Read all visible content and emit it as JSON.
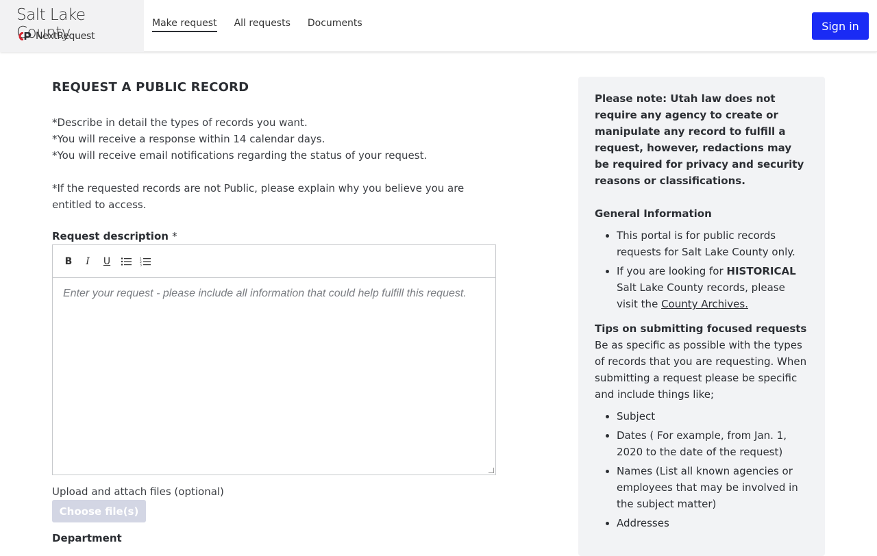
{
  "header": {
    "brand_title": "Salt Lake County",
    "brand_sub": "NextRequest",
    "nav": [
      "Make request",
      "All requests",
      "Documents"
    ],
    "sign_in": "Sign in"
  },
  "main": {
    "title": "REQUEST A PUBLIC RECORD",
    "intro_lines": [
      "*Describe in detail the types of records you want.",
      "*You will receive a response within 14 calendar days.",
      "*You will receive email notifications regarding the status of your request.",
      "*If the requested records are not Public, please explain why you believe you are entitled to access."
    ],
    "desc_label": "Request description",
    "required_mark": "*",
    "toolbar": {
      "bold": "B",
      "italic": "I",
      "underline": "U"
    },
    "placeholder": "Enter your request - please include all information that could help fulfill this request.",
    "upload_label": "Upload and attach files (optional)",
    "choose_files": "Choose file(s)",
    "department_label": "Department"
  },
  "sidebar": {
    "note": "Please note: Utah law does not require any agency to create or manipulate any record to fulfill a request, however, redactions may be required for privacy and security reasons or classifications.",
    "general_heading": "General Information",
    "general_item1": "This portal is for public records requests for Salt Lake County only.",
    "general_item2_pre": "If you are looking for ",
    "general_item2_bold": "HISTORICAL",
    "general_item2_mid": " Salt Lake County records, please visit the ",
    "general_item2_link": "County Archives.",
    "tips_heading": "Tips on submitting focused requests",
    "tips_text": "Be as specific as possible with the types of records that you are requesting. When submitting a request please be specific and include things like;",
    "tips_items": [
      "Subject",
      "Dates ( For example, from Jan. 1, 2020 to the date of the request)",
      "Names (List all known agencies or employees that may be involved in the subject matter)",
      "Addresses"
    ]
  },
  "colors": {
    "accent": "#1a2bf5",
    "sidebar_bg": "#f2f3f5",
    "logo_red": "#d4232e"
  }
}
